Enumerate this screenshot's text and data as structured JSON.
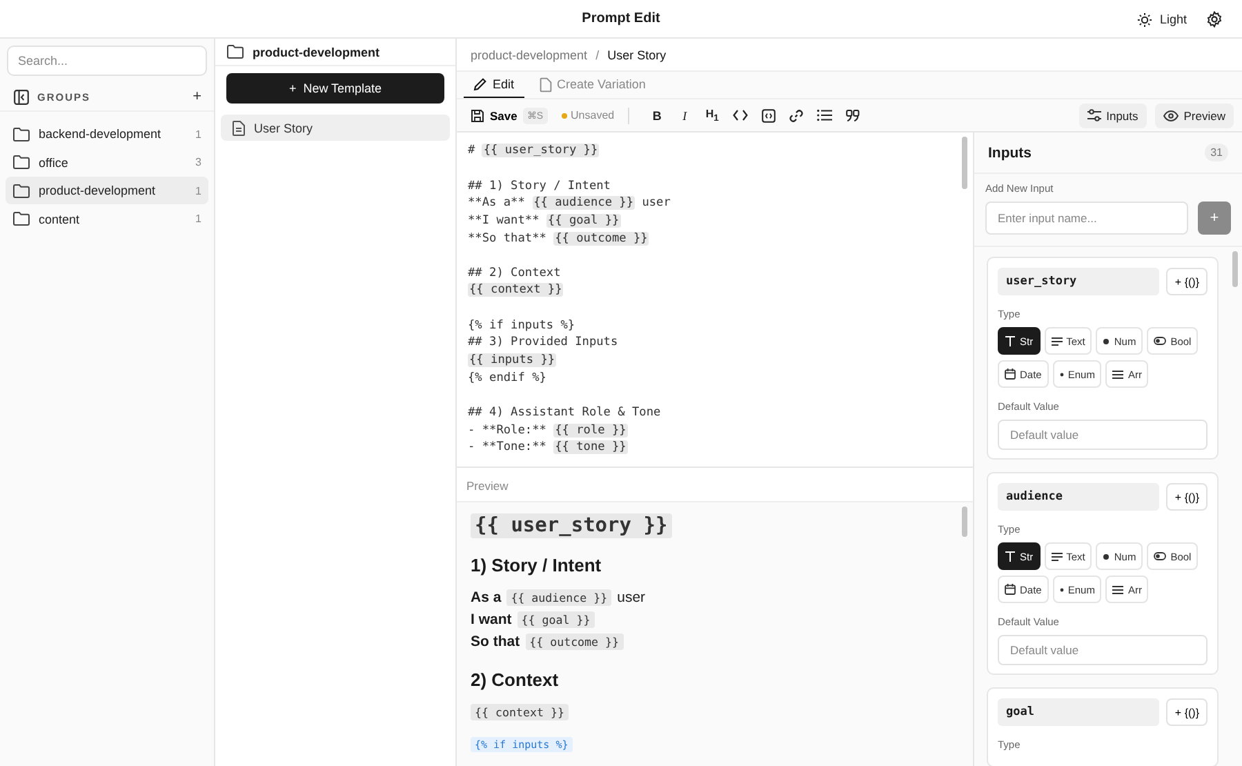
{
  "window": {
    "title": "Prompt Edit",
    "theme_label": "Light"
  },
  "sidebar": {
    "search_placeholder": "Search...",
    "groups_label": "GROUPS",
    "add_label": "+",
    "items": [
      {
        "name": "backend-development",
        "count": "1",
        "selected": false
      },
      {
        "name": "office",
        "count": "3",
        "selected": false
      },
      {
        "name": "product-development",
        "count": "1",
        "selected": true
      },
      {
        "name": "content",
        "count": "1",
        "selected": false
      }
    ]
  },
  "templates": {
    "folder": "product-development",
    "new_button": "New Template",
    "new_glyph": "+",
    "items": [
      {
        "name": "User Story",
        "selected": true
      }
    ]
  },
  "breadcrumb": {
    "parent": "product-development",
    "separator": "/",
    "current": "User Story"
  },
  "tabs": [
    {
      "label": "Edit",
      "kind": "edit",
      "selected": true
    },
    {
      "label": "Create Variation",
      "kind": "variation",
      "selected": false
    }
  ],
  "toolbar": {
    "save": "Save",
    "shortcut": "⌘S",
    "status": "Unsaved",
    "tools": [
      {
        "kind": "bold",
        "glyph": "B"
      },
      {
        "kind": "italic",
        "glyph": "I"
      },
      {
        "kind": "heading",
        "glyph": "H$_{1}$"
      },
      {
        "kind": "code"
      },
      {
        "kind": "code-block"
      },
      {
        "kind": "link"
      },
      {
        "kind": "list"
      },
      {
        "kind": "quote"
      }
    ],
    "inputs_button": "Inputs",
    "preview_button": "Preview"
  },
  "editor": {
    "lines": [
      {
        "kind": "code",
        "segs": [
          {
            "t": "# ",
            "kind": "plain"
          },
          {
            "t": "{{ user_story }}",
            "kind": "var"
          }
        ]
      },
      {
        "kind": "blank"
      },
      {
        "kind": "code",
        "segs": [
          {
            "t": "## 1) Story / Intent",
            "kind": "plain"
          }
        ]
      },
      {
        "kind": "code",
        "segs": [
          {
            "t": "**As a** ",
            "kind": "plain"
          },
          {
            "t": "{{ audience }}",
            "kind": "var"
          },
          {
            "t": " user",
            "kind": "plain"
          }
        ]
      },
      {
        "kind": "code",
        "segs": [
          {
            "t": "**I want** ",
            "kind": "plain"
          },
          {
            "t": "{{ goal }}",
            "kind": "var"
          }
        ]
      },
      {
        "kind": "code",
        "segs": [
          {
            "t": "**So that** ",
            "kind": "plain"
          },
          {
            "t": "{{ outcome }}",
            "kind": "var"
          }
        ]
      },
      {
        "kind": "blank"
      },
      {
        "kind": "code",
        "segs": [
          {
            "t": "## 2) Context",
            "kind": "plain"
          }
        ]
      },
      {
        "kind": "code",
        "segs": [
          {
            "t": "{{ context }}",
            "kind": "var"
          }
        ]
      },
      {
        "kind": "blank"
      },
      {
        "kind": "code",
        "segs": [
          {
            "t": "{% if inputs %}",
            "kind": "plain"
          }
        ]
      },
      {
        "kind": "code",
        "segs": [
          {
            "t": "## 3) Provided Inputs",
            "kind": "plain"
          }
        ]
      },
      {
        "kind": "code",
        "segs": [
          {
            "t": "{{ inputs }}",
            "kind": "var"
          }
        ]
      },
      {
        "kind": "code",
        "segs": [
          {
            "t": "{% endif %}",
            "kind": "plain"
          }
        ]
      },
      {
        "kind": "blank"
      },
      {
        "kind": "code",
        "segs": [
          {
            "t": "## 4) Assistant Role & Tone",
            "kind": "plain"
          }
        ]
      },
      {
        "kind": "code",
        "segs": [
          {
            "t": "- **Role:** ",
            "kind": "plain"
          },
          {
            "t": "{{ role }}",
            "kind": "var"
          }
        ]
      },
      {
        "kind": "code",
        "segs": [
          {
            "t": "- **Tone:** ",
            "kind": "plain"
          },
          {
            "t": "{{ tone }}",
            "kind": "var"
          }
        ]
      }
    ]
  },
  "preview": {
    "label": "Preview",
    "blocks": [
      {
        "kind": "h1",
        "segs": [
          {
            "t": "{{ user_story }}",
            "kind": "var"
          }
        ]
      },
      {
        "kind": "h2",
        "segs": [
          {
            "t": "1) Story / Intent",
            "kind": "plain"
          }
        ]
      },
      {
        "kind": "p",
        "segs": [
          {
            "t": "As a",
            "kind": "bold"
          },
          {
            "t": "{{ audience }}",
            "kind": "var"
          },
          {
            "t": "user",
            "kind": "plain"
          }
        ]
      },
      {
        "kind": "p",
        "segs": [
          {
            "t": "I want",
            "kind": "bold"
          },
          {
            "t": "{{ goal }}",
            "kind": "var"
          }
        ]
      },
      {
        "kind": "p",
        "segs": [
          {
            "t": "So that",
            "kind": "bold"
          },
          {
            "t": "{{ outcome }}",
            "kind": "var"
          }
        ]
      },
      {
        "kind": "h2",
        "segs": [
          {
            "t": "2) Context",
            "kind": "plain"
          }
        ]
      },
      {
        "kind": "p",
        "segs": [
          {
            "t": "{{ context }}",
            "kind": "var"
          }
        ]
      },
      {
        "kind": "p",
        "segs": [
          {
            "t": "{% if inputs %}",
            "kind": "tag"
          }
        ]
      }
    ]
  },
  "inputs": {
    "title": "Inputs",
    "count": "31",
    "add_label": "Add New Input",
    "add_placeholder": "Enter input name...",
    "add_glyph": "+",
    "cards": [
      {
        "name": "user_story",
        "insert": "+ {()}",
        "type_label": "Type",
        "types": [
          {
            "label": "Str",
            "kind": "str",
            "selected": true
          },
          {
            "label": "Text",
            "kind": "text",
            "selected": false
          },
          {
            "label": "Num",
            "kind": "num",
            "selected": false
          },
          {
            "label": "Bool",
            "kind": "bool",
            "selected": false
          },
          {
            "label": "Date",
            "kind": "date",
            "selected": false
          },
          {
            "label": "Enum",
            "kind": "enum",
            "selected": false
          },
          {
            "label": "Arr",
            "kind": "arr",
            "selected": false
          }
        ],
        "default_label": "Default Value",
        "default_placeholder": "Default value"
      },
      {
        "name": "audience",
        "insert": "+ {()}",
        "type_label": "Type",
        "types": [
          {
            "label": "Str",
            "kind": "str",
            "selected": true
          },
          {
            "label": "Text",
            "kind": "text",
            "selected": false
          },
          {
            "label": "Num",
            "kind": "num",
            "selected": false
          },
          {
            "label": "Bool",
            "kind": "bool",
            "selected": false
          },
          {
            "label": "Date",
            "kind": "date",
            "selected": false
          },
          {
            "label": "Enum",
            "kind": "enum",
            "selected": false
          },
          {
            "label": "Arr",
            "kind": "arr",
            "selected": false
          }
        ],
        "default_label": "Default Value",
        "default_placeholder": "Default value"
      },
      {
        "name": "goal",
        "insert": "+ {()}",
        "type_label": "Type"
      }
    ]
  }
}
